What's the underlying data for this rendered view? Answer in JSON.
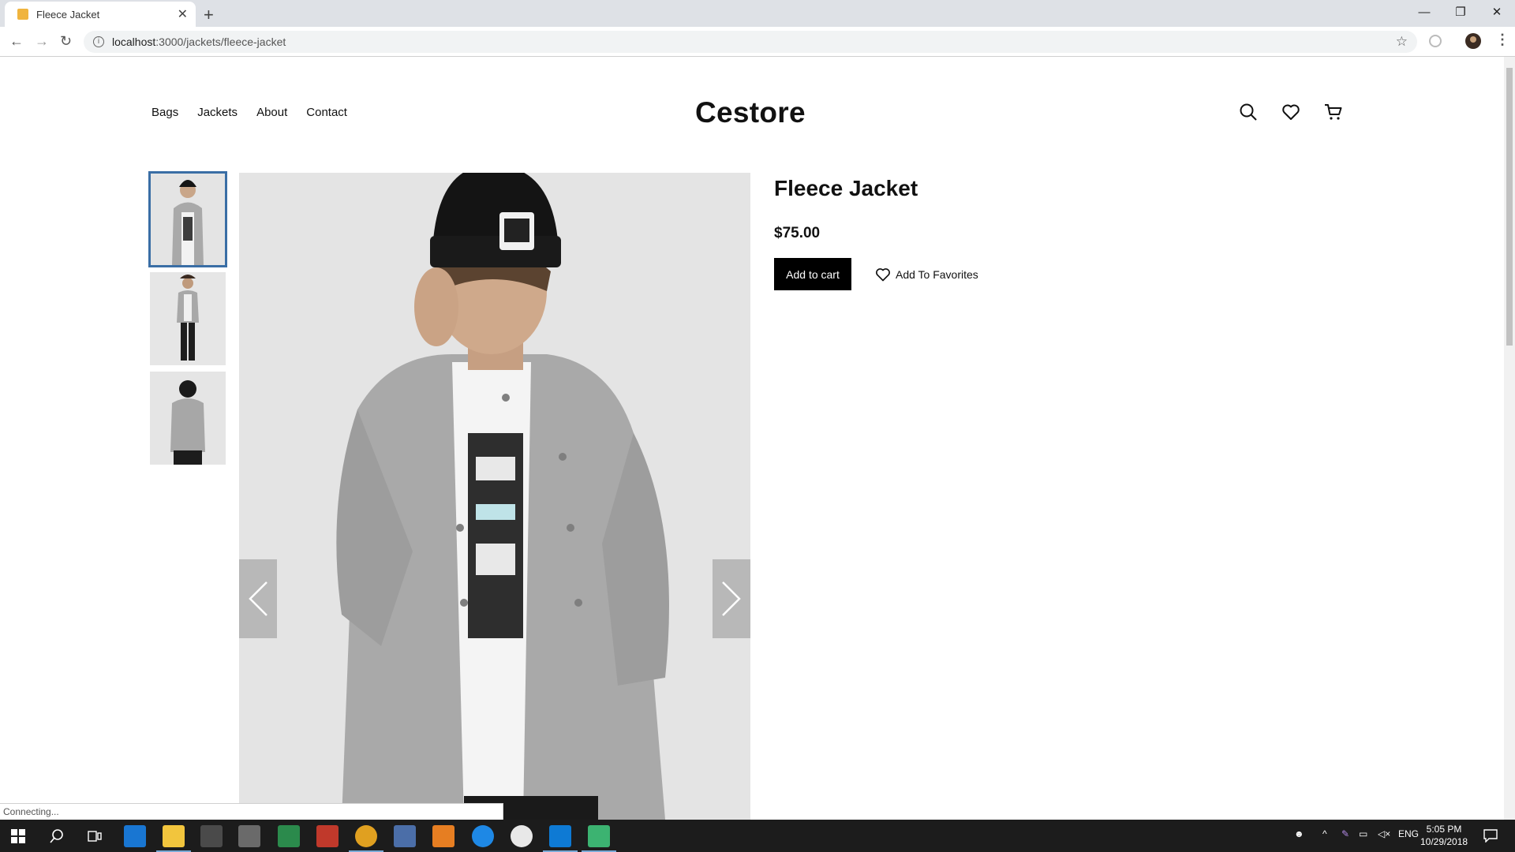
{
  "browser": {
    "tab_title": "Fleece Jacket",
    "url_host": "localhost",
    "url_rest": ":3000/jackets/fleece-jacket",
    "status_text": "Connecting..."
  },
  "site": {
    "brand": "Cestore",
    "nav": [
      "Bags",
      "Jackets",
      "About",
      "Contact"
    ]
  },
  "product": {
    "title": "Fleece Jacket",
    "price": "$75.00",
    "add_to_cart_label": "Add to cart",
    "add_to_favorites_label": "Add To Favorites",
    "thumbnails": [
      "front",
      "full-body",
      "back"
    ],
    "active_thumbnail": 0
  },
  "taskbar": {
    "language": "ENG",
    "time": "5:05 PM",
    "date": "10/29/2018"
  },
  "colors": {
    "accent": "#3a6ea5",
    "button_bg": "#000000"
  }
}
